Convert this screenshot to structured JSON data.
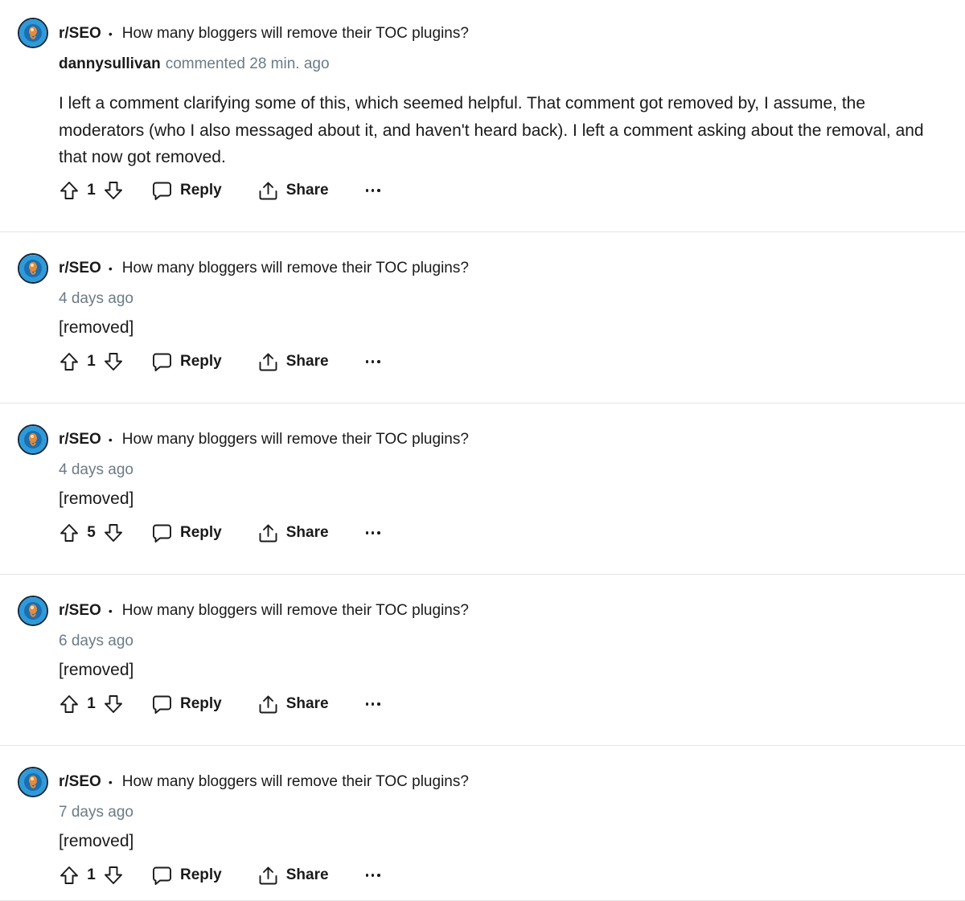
{
  "comments": [
    {
      "subreddit": "r/SEO",
      "separator": "•",
      "post_title": "How many bloggers will remove their TOC plugins?",
      "author": "dannysullivan",
      "meta": "commented 28 min. ago",
      "body": "I left a comment clarifying some of this, which seemed helpful. That comment got removed by, I assume, the moderators (who I also messaged about it, and haven't heard back). I left a comment asking about the removal, and that now got removed.",
      "votes": "1",
      "reply_label": "Reply",
      "share_label": "Share"
    },
    {
      "subreddit": "r/SEO",
      "separator": "•",
      "post_title": "How many bloggers will remove their TOC plugins?",
      "meta": "4 days ago",
      "body": "[removed]",
      "votes": "1",
      "reply_label": "Reply",
      "share_label": "Share"
    },
    {
      "subreddit": "r/SEO",
      "separator": "•",
      "post_title": "How many bloggers will remove their TOC plugins?",
      "meta": "4 days ago",
      "body": "[removed]",
      "votes": "5",
      "reply_label": "Reply",
      "share_label": "Share"
    },
    {
      "subreddit": "r/SEO",
      "separator": "•",
      "post_title": "How many bloggers will remove their TOC plugins?",
      "meta": "6 days ago",
      "body": "[removed]",
      "votes": "1",
      "reply_label": "Reply",
      "share_label": "Share"
    },
    {
      "subreddit": "r/SEO",
      "separator": "•",
      "post_title": "How many bloggers will remove their TOC plugins?",
      "meta": "7 days ago",
      "body": "[removed]",
      "votes": "1",
      "reply_label": "Reply",
      "share_label": "Share"
    }
  ],
  "icons": {
    "avatar": "subreddit-avatar-icon",
    "upvote": "upvote-arrow-icon",
    "downvote": "downvote-arrow-icon",
    "reply": "speech-bubble-icon",
    "share": "share-upload-icon",
    "more": "ellipsis-icon"
  },
  "colors": {
    "text": "#1a1a1b",
    "muted": "#6b7b86",
    "divider": "#e3e5e7",
    "avatar_bg": "#2e9ad9"
  }
}
